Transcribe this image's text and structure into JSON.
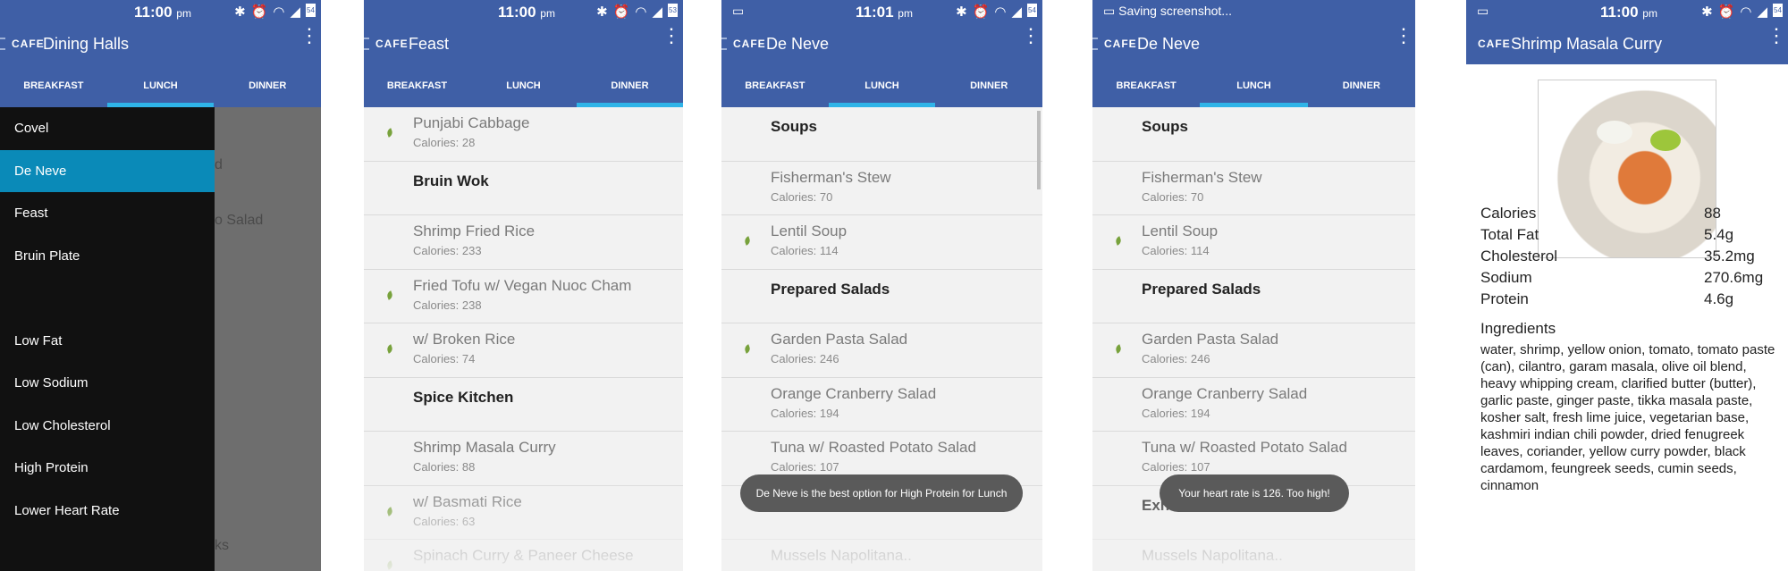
{
  "screens": [
    {
      "notification": "",
      "time": "11:00",
      "ampm": "pm",
      "cafe_label": "CAFE",
      "title": "Dining Halls",
      "tabs": [
        "BREAKFAST",
        "LUNCH",
        "DINNER"
      ],
      "active_tab": 1,
      "drawer": {
        "halls": [
          "Covel",
          "De Neve",
          "Feast",
          "Bruin Plate"
        ],
        "selected": "De Neve",
        "filters": [
          "Low Fat",
          "Low Sodium",
          "Low Cholesterol",
          "High Protein",
          "Lower Heart Rate"
        ]
      },
      "ghost": [
        "d",
        "o Salad",
        "ks"
      ]
    },
    {
      "time": "11:00",
      "ampm": "pm",
      "cafe_label": "CAFE",
      "title": "Feast",
      "tabs": [
        "BREAKFAST",
        "LUNCH",
        "DINNER"
      ],
      "active_tab": 2,
      "rows": [
        {
          "name": "Punjabi Cabbage",
          "cal": "Calories: 28",
          "leaf": true
        },
        {
          "name": "Bruin Wok",
          "heading": true
        },
        {
          "name": "Shrimp Fried Rice",
          "cal": "Calories: 233"
        },
        {
          "name": "Fried Tofu w/ Vegan Nuoc Cham",
          "cal": "Calories: 238",
          "leaf": true
        },
        {
          "name": "  w/ Broken Rice",
          "cal": "Calories: 74",
          "leaf": true
        },
        {
          "name": "Spice Kitchen",
          "heading": true
        },
        {
          "name": "Shrimp Masala Curry",
          "cal": "Calories: 88"
        },
        {
          "name": "  w/ Basmati Rice",
          "cal": "Calories: 63",
          "leaf": true
        },
        {
          "name": "Spinach Curry & Paneer Cheese",
          "cal": "",
          "leaf": true
        }
      ]
    },
    {
      "time": "11:01",
      "ampm": "pm",
      "cafe_label": "CAFE",
      "title": "De Neve",
      "tabs": [
        "BREAKFAST",
        "LUNCH",
        "DINNER"
      ],
      "active_tab": 1,
      "rows": [
        {
          "name": "Soups",
          "heading": true
        },
        {
          "name": "Fisherman's Stew",
          "cal": "Calories: 70"
        },
        {
          "name": "Lentil Soup",
          "cal": "Calories: 114",
          "leaf": true
        },
        {
          "name": "Prepared Salads",
          "heading": true
        },
        {
          "name": "Garden Pasta Salad",
          "cal": "Calories: 246",
          "leaf": true
        },
        {
          "name": "Orange Cranberry Salad",
          "cal": "Calories: 194"
        },
        {
          "name": "Tuna w/ Roasted Potato Salad",
          "cal": "Calories: 107"
        },
        {
          "name": "Exhibition Kitchen",
          "heading": true
        },
        {
          "name": "Mussels Napolitana..",
          "cal": ""
        }
      ],
      "toast": "De Neve is the best option for High Protein for Lunch"
    },
    {
      "notification": "Saving screenshot...",
      "time": "",
      "ampm": "",
      "cafe_label": "CAFE",
      "title": "De Neve",
      "tabs": [
        "BREAKFAST",
        "LUNCH",
        "DINNER"
      ],
      "active_tab": 1,
      "rows": [
        {
          "name": "Soups",
          "heading": true
        },
        {
          "name": "Fisherman's Stew",
          "cal": "Calories: 70"
        },
        {
          "name": "Lentil Soup",
          "cal": "Calories: 114",
          "leaf": true
        },
        {
          "name": "Prepared Salads",
          "heading": true
        },
        {
          "name": "Garden Pasta Salad",
          "cal": "Calories: 246",
          "leaf": true
        },
        {
          "name": "Orange Cranberry Salad",
          "cal": "Calories: 194"
        },
        {
          "name": "Tuna w/ Roasted Potato Salad",
          "cal": "Calories: 107"
        },
        {
          "name": "Exhibition Kitchen",
          "heading": true
        },
        {
          "name": "Mussels Napolitana..",
          "cal": ""
        }
      ],
      "toast": "Your heart rate is 126. Too high!"
    },
    {
      "time": "11:00",
      "ampm": "pm",
      "cafe_label": "CAFE",
      "title": "Shrimp Masala Curry",
      "nutrition": [
        {
          "label": "Calories",
          "value": "88"
        },
        {
          "label": "Total Fat",
          "value": "5.4g"
        },
        {
          "label": "Cholesterol",
          "value": "35.2mg"
        },
        {
          "label": "Sodium",
          "value": "270.6mg"
        },
        {
          "label": "Protein",
          "value": "4.6g"
        }
      ],
      "ingredients_title": "Ingredients",
      "ingredients": "water, shrimp, yellow onion, tomato, tomato paste (can), cilantro, garam masala, olive oil blend, heavy whipping cream, clarified butter (butter), garlic paste, ginger paste, tikka masala paste, kosher salt, fresh lime juice, vegetarian base, kashmiri indian chili powder, dried fenugreek leaves, coriander, yellow curry powder, black cardamom, feungreek seeds, cumin seeds, cinnamon"
    }
  ],
  "colors": {
    "bar": "#3f5fa6",
    "tab_indicator": "#2fb4e8",
    "drawer_selected": "#0a8ab8",
    "leaf": "#78a23c"
  }
}
